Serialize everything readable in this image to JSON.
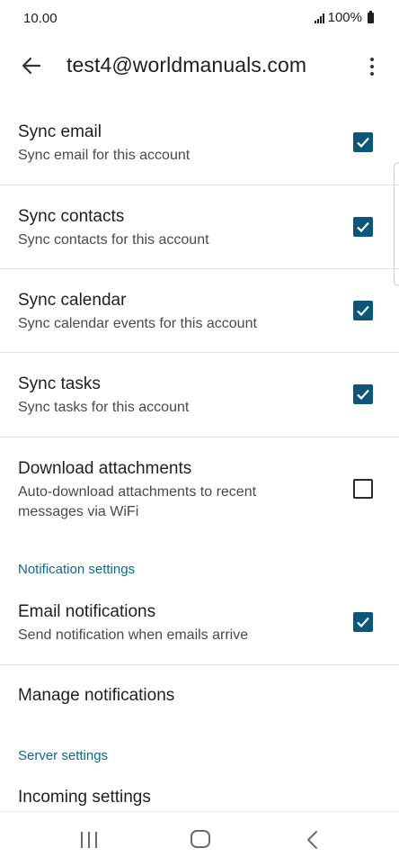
{
  "status": {
    "time": "10.00",
    "battery": "100%"
  },
  "header": {
    "title": "test4@worldmanuals.com"
  },
  "settings": [
    {
      "title": "Sync email",
      "subtitle": "Sync email for this account",
      "checked": true
    },
    {
      "title": "Sync contacts",
      "subtitle": "Sync contacts for this account",
      "checked": true
    },
    {
      "title": "Sync calendar",
      "subtitle": "Sync calendar events for this account",
      "checked": true
    },
    {
      "title": "Sync tasks",
      "subtitle": "Sync tasks for this account",
      "checked": true
    },
    {
      "title": "Download attachments",
      "subtitle_line1": "Auto-download attachments to recent",
      "subtitle_line2": "messages via WiFi",
      "checked": false
    }
  ],
  "notification_section": {
    "header": "Notification settings",
    "email_notifications": {
      "title": "Email notifications",
      "subtitle": "Send notification when emails arrive",
      "checked": true
    },
    "manage_notifications": "Manage notifications"
  },
  "server_section": {
    "header": "Server settings",
    "incoming_settings": "Incoming settings"
  },
  "colors": {
    "accent": "#0c5677",
    "section_header": "#0c6a8d"
  }
}
